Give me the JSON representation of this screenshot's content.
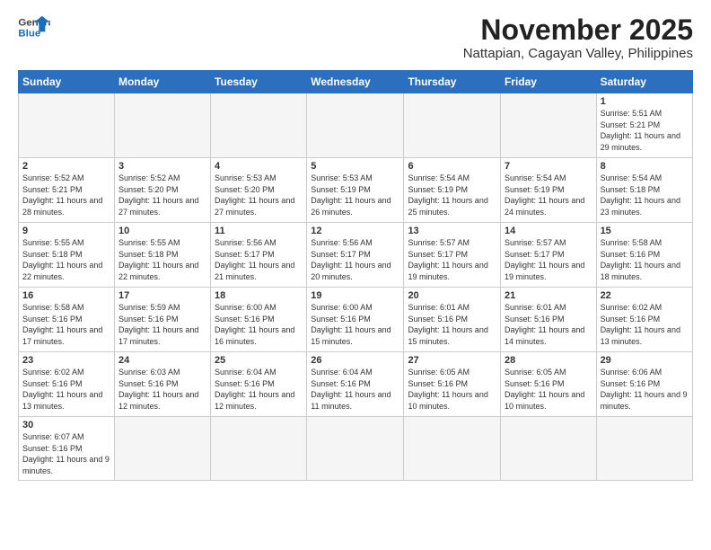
{
  "header": {
    "logo_general": "General",
    "logo_blue": "Blue",
    "month_title": "November 2025",
    "subtitle": "Nattapian, Cagayan Valley, Philippines"
  },
  "weekdays": [
    "Sunday",
    "Monday",
    "Tuesday",
    "Wednesday",
    "Thursday",
    "Friday",
    "Saturday"
  ],
  "weeks": [
    [
      {
        "day": "",
        "info": ""
      },
      {
        "day": "",
        "info": ""
      },
      {
        "day": "",
        "info": ""
      },
      {
        "day": "",
        "info": ""
      },
      {
        "day": "",
        "info": ""
      },
      {
        "day": "",
        "info": ""
      },
      {
        "day": "1",
        "info": "Sunrise: 5:51 AM\nSunset: 5:21 PM\nDaylight: 11 hours\nand 29 minutes."
      }
    ],
    [
      {
        "day": "2",
        "info": "Sunrise: 5:52 AM\nSunset: 5:21 PM\nDaylight: 11 hours\nand 28 minutes."
      },
      {
        "day": "3",
        "info": "Sunrise: 5:52 AM\nSunset: 5:20 PM\nDaylight: 11 hours\nand 27 minutes."
      },
      {
        "day": "4",
        "info": "Sunrise: 5:53 AM\nSunset: 5:20 PM\nDaylight: 11 hours\nand 27 minutes."
      },
      {
        "day": "5",
        "info": "Sunrise: 5:53 AM\nSunset: 5:19 PM\nDaylight: 11 hours\nand 26 minutes."
      },
      {
        "day": "6",
        "info": "Sunrise: 5:54 AM\nSunset: 5:19 PM\nDaylight: 11 hours\nand 25 minutes."
      },
      {
        "day": "7",
        "info": "Sunrise: 5:54 AM\nSunset: 5:19 PM\nDaylight: 11 hours\nand 24 minutes."
      },
      {
        "day": "8",
        "info": "Sunrise: 5:54 AM\nSunset: 5:18 PM\nDaylight: 11 hours\nand 23 minutes."
      }
    ],
    [
      {
        "day": "9",
        "info": "Sunrise: 5:55 AM\nSunset: 5:18 PM\nDaylight: 11 hours\nand 22 minutes."
      },
      {
        "day": "10",
        "info": "Sunrise: 5:55 AM\nSunset: 5:18 PM\nDaylight: 11 hours\nand 22 minutes."
      },
      {
        "day": "11",
        "info": "Sunrise: 5:56 AM\nSunset: 5:17 PM\nDaylight: 11 hours\nand 21 minutes."
      },
      {
        "day": "12",
        "info": "Sunrise: 5:56 AM\nSunset: 5:17 PM\nDaylight: 11 hours\nand 20 minutes."
      },
      {
        "day": "13",
        "info": "Sunrise: 5:57 AM\nSunset: 5:17 PM\nDaylight: 11 hours\nand 19 minutes."
      },
      {
        "day": "14",
        "info": "Sunrise: 5:57 AM\nSunset: 5:17 PM\nDaylight: 11 hours\nand 19 minutes."
      },
      {
        "day": "15",
        "info": "Sunrise: 5:58 AM\nSunset: 5:16 PM\nDaylight: 11 hours\nand 18 minutes."
      }
    ],
    [
      {
        "day": "16",
        "info": "Sunrise: 5:58 AM\nSunset: 5:16 PM\nDaylight: 11 hours\nand 17 minutes."
      },
      {
        "day": "17",
        "info": "Sunrise: 5:59 AM\nSunset: 5:16 PM\nDaylight: 11 hours\nand 17 minutes."
      },
      {
        "day": "18",
        "info": "Sunrise: 6:00 AM\nSunset: 5:16 PM\nDaylight: 11 hours\nand 16 minutes."
      },
      {
        "day": "19",
        "info": "Sunrise: 6:00 AM\nSunset: 5:16 PM\nDaylight: 11 hours\nand 15 minutes."
      },
      {
        "day": "20",
        "info": "Sunrise: 6:01 AM\nSunset: 5:16 PM\nDaylight: 11 hours\nand 15 minutes."
      },
      {
        "day": "21",
        "info": "Sunrise: 6:01 AM\nSunset: 5:16 PM\nDaylight: 11 hours\nand 14 minutes."
      },
      {
        "day": "22",
        "info": "Sunrise: 6:02 AM\nSunset: 5:16 PM\nDaylight: 11 hours\nand 13 minutes."
      }
    ],
    [
      {
        "day": "23",
        "info": "Sunrise: 6:02 AM\nSunset: 5:16 PM\nDaylight: 11 hours\nand 13 minutes."
      },
      {
        "day": "24",
        "info": "Sunrise: 6:03 AM\nSunset: 5:16 PM\nDaylight: 11 hours\nand 12 minutes."
      },
      {
        "day": "25",
        "info": "Sunrise: 6:04 AM\nSunset: 5:16 PM\nDaylight: 11 hours\nand 12 minutes."
      },
      {
        "day": "26",
        "info": "Sunrise: 6:04 AM\nSunset: 5:16 PM\nDaylight: 11 hours\nand 11 minutes."
      },
      {
        "day": "27",
        "info": "Sunrise: 6:05 AM\nSunset: 5:16 PM\nDaylight: 11 hours\nand 10 minutes."
      },
      {
        "day": "28",
        "info": "Sunrise: 6:05 AM\nSunset: 5:16 PM\nDaylight: 11 hours\nand 10 minutes."
      },
      {
        "day": "29",
        "info": "Sunrise: 6:06 AM\nSunset: 5:16 PM\nDaylight: 11 hours\nand 9 minutes."
      }
    ],
    [
      {
        "day": "30",
        "info": "Sunrise: 6:07 AM\nSunset: 5:16 PM\nDaylight: 11 hours\nand 9 minutes."
      },
      {
        "day": "",
        "info": ""
      },
      {
        "day": "",
        "info": ""
      },
      {
        "day": "",
        "info": ""
      },
      {
        "day": "",
        "info": ""
      },
      {
        "day": "",
        "info": ""
      },
      {
        "day": "",
        "info": ""
      }
    ]
  ]
}
